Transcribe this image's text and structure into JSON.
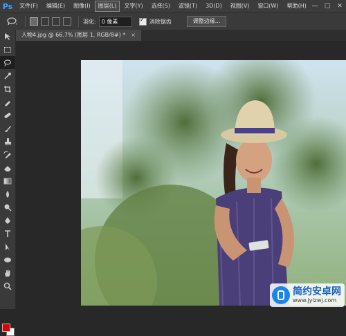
{
  "app": {
    "logo": "Ps"
  },
  "menu": [
    {
      "label": "文件(F)"
    },
    {
      "label": "编辑(E)"
    },
    {
      "label": "图像(I)"
    },
    {
      "label": "图层(L)",
      "active": true
    },
    {
      "label": "文字(Y)"
    },
    {
      "label": "选择(S)"
    },
    {
      "label": "滤镜(T)"
    },
    {
      "label": "3D(D)"
    },
    {
      "label": "视图(V)"
    },
    {
      "label": "窗口(W)"
    },
    {
      "label": "帮助(H)"
    }
  ],
  "window_controls": {
    "minimize": "—",
    "restore": "□",
    "close": "✕"
  },
  "options": {
    "feather_label": "羽化:",
    "feather_value": "0 像素",
    "antialias_label": "消除锯齿",
    "antialias_checked": true,
    "refine_button": "调整边缘..."
  },
  "document_tab": {
    "title": "人物4.jpg @ 66.7% (图层 1, RGB/8#) *",
    "close": "×"
  },
  "tools": [
    "move-tool",
    "marquee-tool",
    "lasso-tool",
    "quick-select-tool",
    "crop-tool",
    "eyedropper-tool",
    "healing-brush-tool",
    "brush-tool",
    "clone-stamp-tool",
    "history-brush-tool",
    "eraser-tool",
    "gradient-tool",
    "blur-tool",
    "dodge-tool",
    "pen-tool",
    "type-tool",
    "path-select-tool",
    "ellipse-tool",
    "hand-tool",
    "zoom-tool"
  ],
  "colors": {
    "foreground": "#e00000",
    "background": "#ffffff",
    "accent": "#31a8ff"
  },
  "watermark": {
    "title": "简约安卓网",
    "url": "www.jylzwj.com"
  }
}
